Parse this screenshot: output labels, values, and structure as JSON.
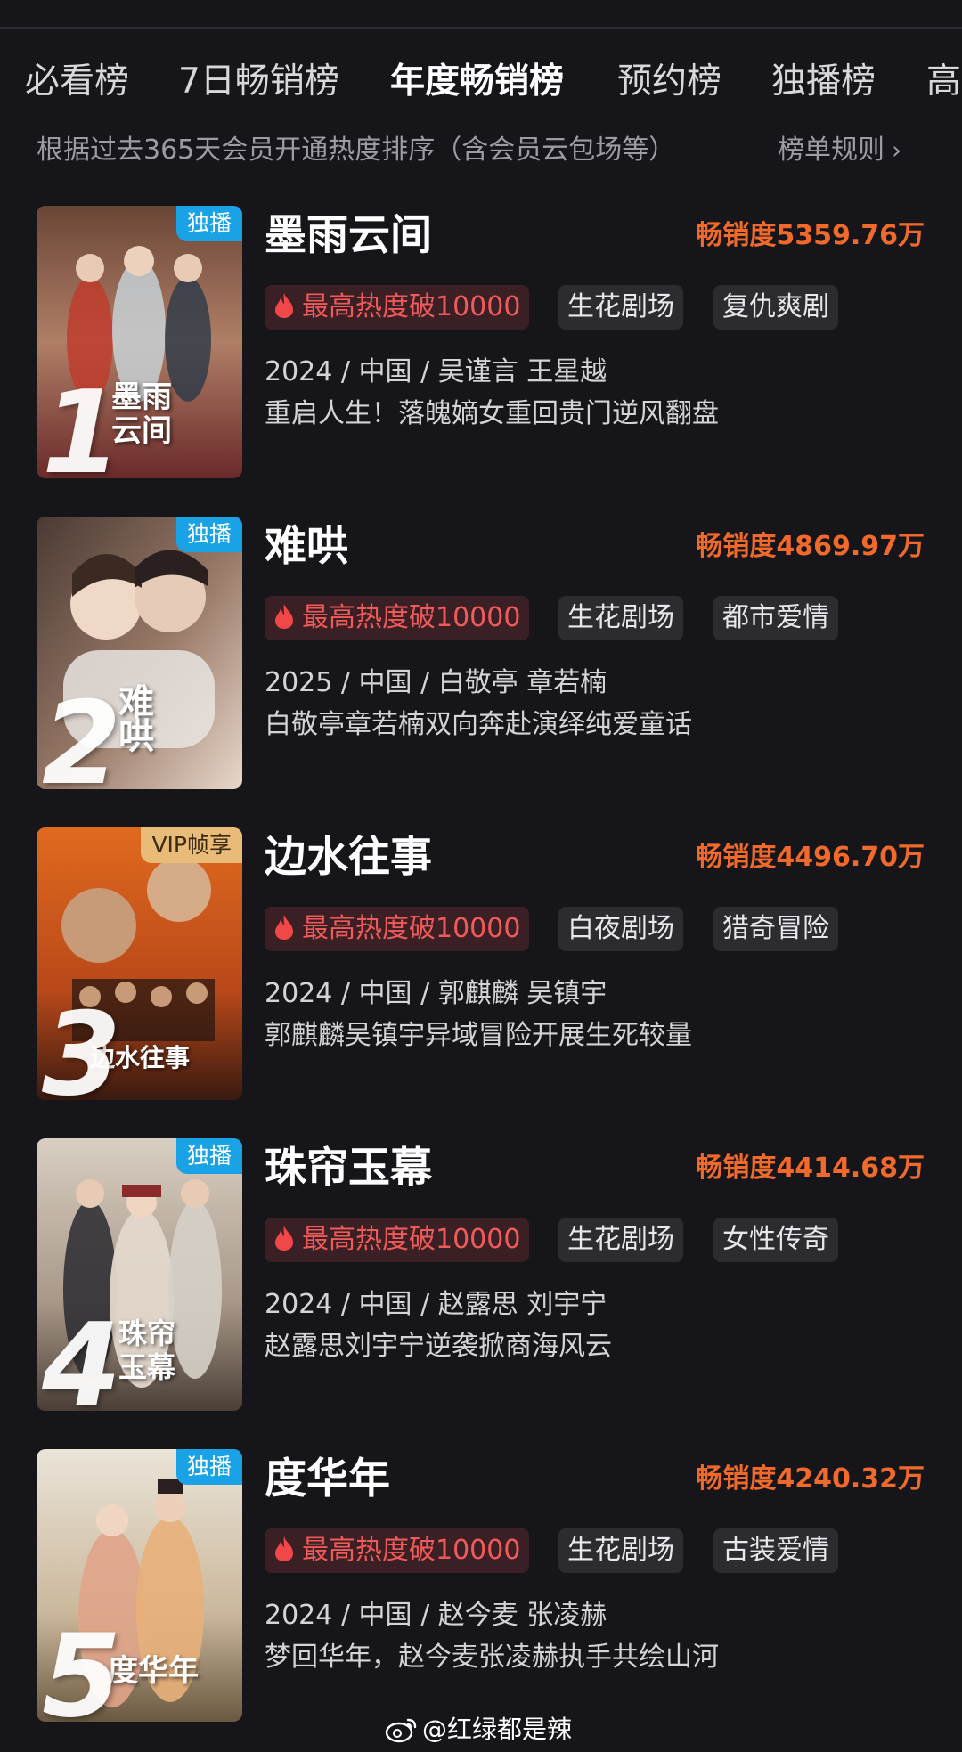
{
  "tabs": [
    {
      "label": "必看榜",
      "active": false
    },
    {
      "label": "7日畅销榜",
      "active": false
    },
    {
      "label": "年度畅销榜",
      "active": true
    },
    {
      "label": "预约榜",
      "active": false
    },
    {
      "label": "独播榜",
      "active": false
    },
    {
      "label": "高",
      "active": false
    }
  ],
  "subtitle": "根据过去365天会员开通热度排序（含会员云包场等）",
  "rules_label": "榜单规则",
  "items": [
    {
      "rank": "1",
      "badge": "独播",
      "badge_style": "blue",
      "poster_text": "墨雨\n云间",
      "title": "墨雨云间",
      "sales": "畅销度5359.76万",
      "hot": "最高热度破10000",
      "tags": [
        "生花剧场",
        "复仇爽剧"
      ],
      "meta": "2024 / 中国 / 吴谨言 王星越",
      "desc": "重启人生！落魄嫡女重回贵门逆风翻盘",
      "colors": [
        "#8a5a44",
        "#c99a80",
        "#5a3a30"
      ]
    },
    {
      "rank": "2",
      "badge": "独播",
      "badge_style": "blue",
      "poster_text": "难哄",
      "title": "难哄",
      "sales": "畅销度4869.97万",
      "hot": "最高热度破10000",
      "tags": [
        "生花剧场",
        "都市爱情"
      ],
      "meta": "2025 / 中国 / 白敬亭 章若楠",
      "desc": "白敬亭章若楠双向奔赴演绎纯爱童话",
      "colors": [
        "#7a5a48",
        "#d8b8a0",
        "#3a2820"
      ]
    },
    {
      "rank": "3",
      "badge": "VIP帧享",
      "badge_style": "gold",
      "poster_text": "边水往事",
      "title": "边水往事",
      "sales": "畅销度4496.70万",
      "hot": "最高热度破10000",
      "tags": [
        "白夜剧场",
        "猎奇冒险"
      ],
      "meta": "2024 / 中国 / 郭麒麟 吴镇宇",
      "desc": "郭麒麟吴镇宇异域冒险开展生死较量",
      "colors": [
        "#d8601c",
        "#f0983a",
        "#5a2a14"
      ]
    },
    {
      "rank": "4",
      "badge": "独播",
      "badge_style": "blue",
      "poster_text": "珠帘\n玉幕",
      "title": "珠帘玉幕",
      "sales": "畅销度4414.68万",
      "hot": "最高热度破10000",
      "tags": [
        "生花剧场",
        "女性传奇"
      ],
      "meta": "2024 / 中国 / 赵露思 刘宇宁",
      "desc": "赵露思刘宇宁逆袭掀商海风云",
      "colors": [
        "#b8a898",
        "#e6dcd0",
        "#5a4a40"
      ]
    },
    {
      "rank": "5",
      "badge": "独播",
      "badge_style": "blue",
      "poster_text": "度华年",
      "title": "度华年",
      "sales": "畅销度4240.32万",
      "hot": "最高热度破10000",
      "tags": [
        "生花剧场",
        "古装爱情"
      ],
      "meta": "2024 / 中国 / 赵今麦 张凌赫",
      "desc": "梦回华年，赵今麦张凌赫执手共绘山河",
      "colors": [
        "#c8b8a0",
        "#eae2d2",
        "#7a6048"
      ]
    }
  ],
  "watermark": "@红绿都是辣",
  "icons": {
    "hot": "flame-icon",
    "rules": "chevron-right-icon",
    "watermark": "weibo-logo-icon"
  }
}
